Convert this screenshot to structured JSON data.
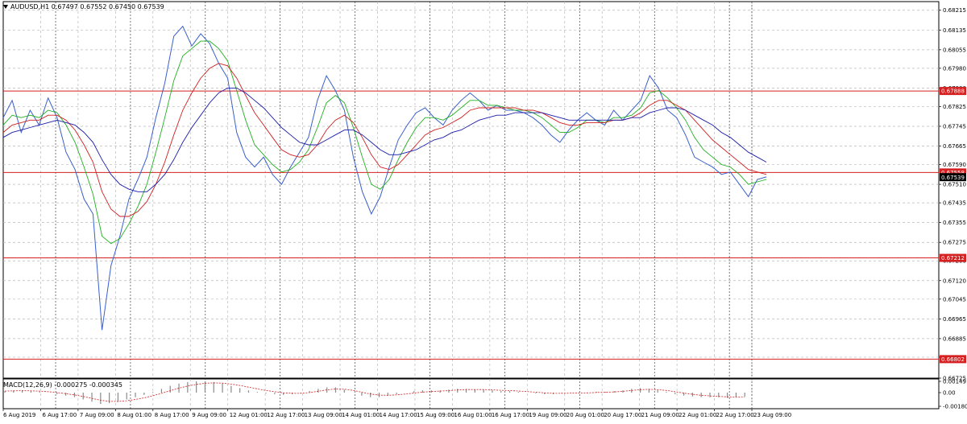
{
  "header": {
    "symbol": "AUDUSD,H1",
    "ohlc": "0.67497 0.67552 0.67450 0.67539"
  },
  "macd": {
    "title": "MACD(12,26,9) -0.000275 -0.000345",
    "ticks": [
      {
        "label": "0.001491",
        "value": 0.001491
      },
      {
        "label": "0.00",
        "value": 0
      },
      {
        "label": "-0.001808",
        "value": -0.001808
      }
    ]
  },
  "colors": {
    "price": "#3a5fcd",
    "ma_fast": "#20b020",
    "ma_mid": "#d02020",
    "ma_slow": "#1c1ca8",
    "level": "#d42020",
    "current": "#000000"
  },
  "chart_data": {
    "type": "line",
    "grid": true,
    "ylim": [
      0.66725,
      0.6825
    ],
    "y_ticks": [
      "0.68215",
      "0.68135",
      "0.68055",
      "0.67980",
      "0.67900",
      "0.67825",
      "0.67745",
      "0.67665",
      "0.67590",
      "0.67510",
      "0.67435",
      "0.67355",
      "0.67275",
      "0.67200",
      "0.67120",
      "0.67045",
      "0.66965",
      "0.66885",
      "0.66810",
      "0.66725"
    ],
    "x_ticks": [
      "6 Aug 2019",
      "6 Aug 17:00",
      "7 Aug 09:00",
      "8 Aug 01:00",
      "8 Aug 17:00",
      "9 Aug 09:00",
      "12 Aug 01:00",
      "12 Aug 17:00",
      "13 Aug 09:00",
      "14 Aug 01:00",
      "14 Aug 17:00",
      "15 Aug 09:00",
      "16 Aug 01:00",
      "16 Aug 17:00",
      "19 Aug 09:00",
      "20 Aug 01:00",
      "20 Aug 17:00",
      "21 Aug 09:00",
      "22 Aug 01:00",
      "22 Aug 17:00",
      "23 Aug 09:00"
    ],
    "levels": [
      {
        "label": "0.67888",
        "value": 0.67888
      },
      {
        "label": "0.67558",
        "value": 0.67558
      },
      {
        "label": "0.67212",
        "value": 0.67212
      },
      {
        "label": "0.66802",
        "value": 0.66802
      }
    ],
    "current": {
      "label": "0.67539",
      "value": 0.67539
    },
    "series": [
      {
        "key": "price",
        "values": [
          0.6778,
          0.6785,
          0.6772,
          0.6781,
          0.6775,
          0.6786,
          0.6778,
          0.6764,
          0.6757,
          0.6745,
          0.6739,
          0.6692,
          0.6718,
          0.673,
          0.6745,
          0.6753,
          0.6762,
          0.6778,
          0.6792,
          0.6811,
          0.6815,
          0.6807,
          0.6812,
          0.6808,
          0.68,
          0.6794,
          0.6772,
          0.6762,
          0.6758,
          0.6762,
          0.6755,
          0.6751,
          0.6758,
          0.6764,
          0.677,
          0.6785,
          0.6795,
          0.6789,
          0.6781,
          0.6762,
          0.6748,
          0.6739,
          0.6746,
          0.6758,
          0.6769,
          0.6775,
          0.678,
          0.6782,
          0.6778,
          0.6775,
          0.6781,
          0.6785,
          0.6788,
          0.6785,
          0.6781,
          0.6783,
          0.6781,
          0.6781,
          0.678,
          0.6778,
          0.6775,
          0.6771,
          0.6768,
          0.6773,
          0.6777,
          0.678,
          0.6777,
          0.6775,
          0.6781,
          0.6777,
          0.6781,
          0.6785,
          0.6795,
          0.679,
          0.6781,
          0.6778,
          0.6771,
          0.6762,
          0.676,
          0.6758,
          0.6755,
          0.6756,
          0.6751,
          0.6746,
          0.6753,
          0.6754
        ]
      },
      {
        "key": "ma_fast",
        "values": [
          0.6775,
          0.6779,
          0.6778,
          0.6779,
          0.6778,
          0.6781,
          0.678,
          0.6775,
          0.6768,
          0.6758,
          0.6747,
          0.673,
          0.6727,
          0.6729,
          0.6735,
          0.6742,
          0.6751,
          0.6764,
          0.6778,
          0.6793,
          0.6803,
          0.6806,
          0.6809,
          0.6809,
          0.6806,
          0.6801,
          0.6789,
          0.6777,
          0.6767,
          0.6763,
          0.6759,
          0.6756,
          0.6757,
          0.676,
          0.6765,
          0.6774,
          0.6784,
          0.6787,
          0.6784,
          0.6774,
          0.6762,
          0.6751,
          0.6749,
          0.6753,
          0.6761,
          0.6768,
          0.6774,
          0.6778,
          0.6778,
          0.6777,
          0.6779,
          0.6782,
          0.6785,
          0.6785,
          0.6783,
          0.6783,
          0.6782,
          0.6781,
          0.6781,
          0.678,
          0.6778,
          0.6775,
          0.6772,
          0.6772,
          0.6774,
          0.6777,
          0.6777,
          0.6776,
          0.6778,
          0.6778,
          0.6779,
          0.6782,
          0.6788,
          0.6789,
          0.6786,
          0.6782,
          0.6777,
          0.677,
          0.6765,
          0.6762,
          0.6759,
          0.6758,
          0.6755,
          0.6751,
          0.6752,
          0.6753
        ]
      },
      {
        "key": "ma_mid",
        "values": [
          0.6772,
          0.6775,
          0.6776,
          0.6777,
          0.6777,
          0.6779,
          0.6779,
          0.6777,
          0.6773,
          0.6767,
          0.676,
          0.6748,
          0.6741,
          0.6738,
          0.6738,
          0.674,
          0.6744,
          0.6751,
          0.676,
          0.6771,
          0.6781,
          0.6788,
          0.6794,
          0.6798,
          0.68,
          0.6799,
          0.6794,
          0.6787,
          0.678,
          0.6775,
          0.677,
          0.6765,
          0.6763,
          0.6762,
          0.6763,
          0.6767,
          0.6773,
          0.6777,
          0.6779,
          0.6776,
          0.677,
          0.6763,
          0.6758,
          0.6757,
          0.6759,
          0.6763,
          0.6767,
          0.6771,
          0.6773,
          0.6774,
          0.6776,
          0.6778,
          0.6781,
          0.6782,
          0.6782,
          0.6782,
          0.6782,
          0.6782,
          0.6781,
          0.6781,
          0.678,
          0.6778,
          0.6776,
          0.6775,
          0.6775,
          0.6776,
          0.6776,
          0.6776,
          0.6777,
          0.6777,
          0.6778,
          0.678,
          0.6783,
          0.6785,
          0.6785,
          0.6783,
          0.6781,
          0.6777,
          0.6773,
          0.6769,
          0.6766,
          0.6763,
          0.676,
          0.6757,
          0.6756,
          0.6755
        ]
      },
      {
        "key": "ma_slow",
        "values": [
          0.677,
          0.6772,
          0.6773,
          0.6774,
          0.6775,
          0.6776,
          0.6777,
          0.6776,
          0.6775,
          0.6772,
          0.6768,
          0.6761,
          0.6755,
          0.6751,
          0.6749,
          0.6748,
          0.6748,
          0.6751,
          0.6755,
          0.6761,
          0.6768,
          0.6774,
          0.6779,
          0.6784,
          0.6788,
          0.679,
          0.679,
          0.6788,
          0.6785,
          0.6782,
          0.6778,
          0.6774,
          0.6771,
          0.6768,
          0.6767,
          0.6767,
          0.6769,
          0.6771,
          0.6773,
          0.6773,
          0.6771,
          0.6768,
          0.6765,
          0.6763,
          0.6763,
          0.6764,
          0.6765,
          0.6767,
          0.6769,
          0.677,
          0.6772,
          0.6773,
          0.6775,
          0.6777,
          0.6778,
          0.6779,
          0.6779,
          0.678,
          0.678,
          0.678,
          0.678,
          0.6779,
          0.6778,
          0.6777,
          0.6777,
          0.6777,
          0.6777,
          0.6777,
          0.6777,
          0.6777,
          0.6778,
          0.6778,
          0.678,
          0.6781,
          0.6782,
          0.6782,
          0.6781,
          0.6779,
          0.6777,
          0.6775,
          0.6772,
          0.677,
          0.6767,
          0.6764,
          0.6762,
          0.676
        ]
      }
    ],
    "macd_hist": [
      0.0002,
      0.0003,
      0.0003,
      0.0002,
      0.0001,
      0.0,
      -0.0002,
      -0.0004,
      -0.0006,
      -0.0009,
      -0.0012,
      -0.0015,
      -0.0014,
      -0.0012,
      -0.0009,
      -0.0006,
      -0.0003,
      0.0001,
      0.0005,
      0.0009,
      0.0012,
      0.0014,
      0.0015,
      0.0015,
      0.0014,
      0.0012,
      0.0009,
      0.0006,
      0.0003,
      0.0001,
      -0.0001,
      -0.0002,
      -0.0003,
      -0.0002,
      -0.0001,
      0.0002,
      0.0005,
      0.0007,
      0.0007,
      0.0004,
      0.0,
      -0.0004,
      -0.0006,
      -0.0006,
      -0.0004,
      -0.0002,
      0.0,
      0.0002,
      0.0003,
      0.0003,
      0.0003,
      0.0004,
      0.0005,
      0.0005,
      0.0004,
      0.0004,
      0.0003,
      0.0002,
      0.0002,
      0.0001,
      0.0,
      -0.0001,
      -0.0002,
      -0.0002,
      -0.0001,
      0.0,
      0.0,
      0.0,
      0.0001,
      0.0001,
      0.0002,
      0.0003,
      0.0005,
      0.0006,
      0.0005,
      0.0003,
      0.0001,
      -0.0002,
      -0.0004,
      -0.0005,
      -0.0006,
      -0.0006,
      -0.0006,
      -0.0007,
      -0.0006,
      -0.0005
    ]
  }
}
